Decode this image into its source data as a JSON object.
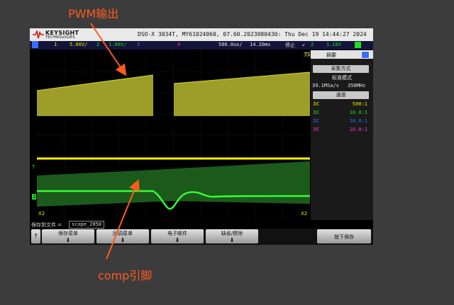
{
  "annotations": {
    "pwm": "PWM输出",
    "comp": "comp引脚"
  },
  "scope": {
    "brand": "KEYSIGHT",
    "brand_sub": "TECHNOLOGIES",
    "title": "DSO-X 3034T, MY61024060, 07.60.2023080430: Thu Dec 19 14:44:27 2024",
    "status": {
      "ch1_num": "1",
      "ch1_scale": "5.00V/",
      "ch2_num": "2",
      "ch2_scale": "1.00V/",
      "ch3_num": "3",
      "ch4_num": "4",
      "timebase": "500.0us/",
      "delay": "14.20ms",
      "run_state": "停止",
      "trig_ch": "2",
      "trig_level": "1.18V"
    },
    "markers": {
      "t1": "T1",
      "x2": "X2",
      "x2b": "X2",
      "m2": "2",
      "t": "T"
    },
    "sidebar": {
      "tab_label": "摘要",
      "acq_button": "采集方式",
      "acq_mode": "标准模式",
      "sample_rate": "39.1MSa/s",
      "bandwidth": "350MHz",
      "channels_button": "通道",
      "channels": [
        {
          "coupling": "DC",
          "probe": "500:1",
          "color": "#e8e800"
        },
        {
          "coupling": "DC",
          "probe": "10.0:1",
          "color": "#22dd22"
        },
        {
          "coupling": "DC",
          "probe": "10.0:1",
          "color": "#3a6dff"
        },
        {
          "coupling": "DC",
          "probe": "10.0:1",
          "color": "#ff2dd0"
        }
      ]
    },
    "save_prefix": "保存到文件 =",
    "save_file": "scope_2050",
    "softkeys": [
      "保存菜单",
      "回调菜单",
      "电子邮件",
      "缺省/擦除"
    ],
    "press_to_save": "按下保存"
  }
}
